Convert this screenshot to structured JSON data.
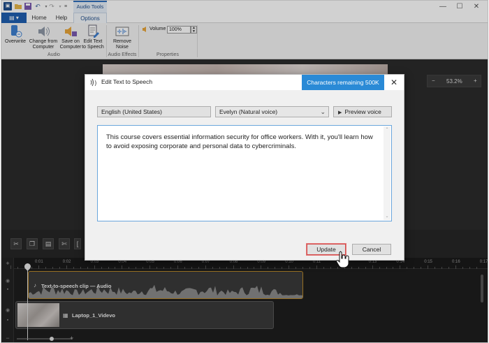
{
  "titlebar": {
    "context_tab": "Audio Tools",
    "file_tab_glyph": "▤ ▾",
    "tabs": [
      {
        "label": "Home"
      },
      {
        "label": "Help"
      },
      {
        "label": "Options"
      }
    ]
  },
  "ribbon": {
    "buttons": [
      {
        "label": "Overwrite",
        "icon": "phone-overwrite-icon"
      },
      {
        "label": "Change from Computer",
        "icon": "speaker-change-icon"
      },
      {
        "label": "Save on Computer",
        "icon": "speaker-save-icon"
      },
      {
        "label": "Edit Text to Speech",
        "icon": "doc-edit-icon"
      },
      {
        "label": "Remove Noise",
        "icon": "waveform-remove-icon"
      }
    ],
    "volume_label": "Volume",
    "volume_value": "100%",
    "groups": [
      {
        "label": "Audio"
      },
      {
        "label": "Audio Effects"
      },
      {
        "label": "Properties"
      }
    ]
  },
  "canvas": {
    "zoom_minus": "−",
    "zoom_value": "53.2%",
    "zoom_plus": "+"
  },
  "timeline": {
    "ruler_labels": [
      "0:01",
      "0:02",
      "0:03",
      "0:04",
      "0:05",
      "0:06",
      "0:07",
      "0:08",
      "0:09",
      "0:10",
      "0:11",
      "0:12",
      "0:13",
      "0:14",
      "0:15",
      "0:16",
      "0:17"
    ],
    "audio_clip_title": "Text-to-speech clip — Audio",
    "video_clip_title": "Laptop_1_Videvo"
  },
  "dialog": {
    "title": "Edit Text to Speech",
    "chars_remaining": "Characters remaining 500K",
    "language": "English (United States)",
    "voice": "Evelyn (Natural voice)",
    "preview_label": "Preview voice",
    "text": "This course covers essential information security for office workers. With it, you'll learn how to avoid exposing corporate and personal data to cybercriminals.",
    "update_label": "Update",
    "cancel_label": "Cancel"
  },
  "colors": {
    "accent": "#2a8ad6",
    "file_tab": "#1f5fb0",
    "audio_clip_border": "#b9882a",
    "update_border": "#d24a4a"
  }
}
